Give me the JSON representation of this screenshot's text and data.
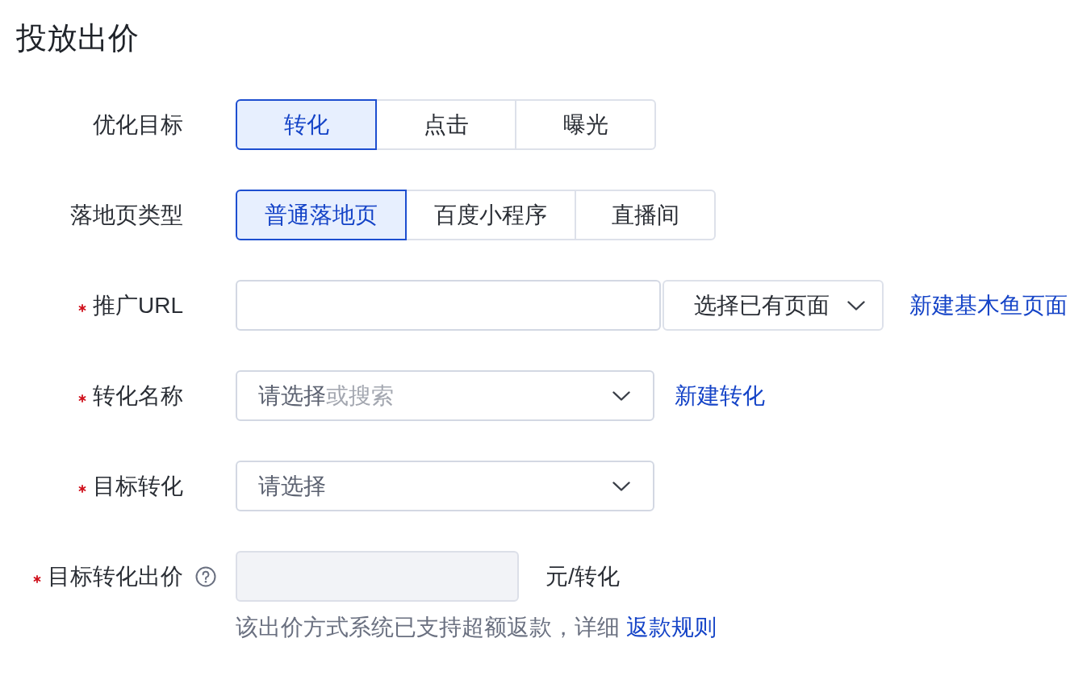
{
  "title": "投放出价",
  "fields": [
    {
      "kind": "segmented",
      "label": "优化目标",
      "required": false,
      "options": [
        {
          "label": "转化",
          "selected": true
        },
        {
          "label": "点击",
          "selected": false
        },
        {
          "label": "曝光",
          "selected": false
        }
      ]
    },
    {
      "kind": "segmented",
      "label": "落地页类型",
      "required": false,
      "options": [
        {
          "label": "普通落地页",
          "selected": true
        },
        {
          "label": "百度小程序",
          "selected": false
        },
        {
          "label": "直播间",
          "selected": false
        }
      ]
    },
    {
      "kind": "url",
      "label": "推广URL",
      "required": true,
      "page_select": "选择已有页面",
      "link": "新建基木鱼页面"
    },
    {
      "kind": "select",
      "label": "转化名称",
      "required": true,
      "placeholder": [
        {
          "text": "请选择",
          "muted": false
        },
        {
          "text": "或搜索",
          "muted": true
        }
      ],
      "link": "新建转化"
    },
    {
      "kind": "select",
      "label": "目标转化",
      "required": true,
      "placeholder": [
        {
          "text": "请选择",
          "muted": false
        }
      ]
    },
    {
      "kind": "amount",
      "label": "目标转化出价",
      "required": true,
      "help_icon": true,
      "disabled": true,
      "unit": "元/转化",
      "note": "该出价方式系统已支持超额返款，详细",
      "note_link": "返款规则"
    }
  ]
}
